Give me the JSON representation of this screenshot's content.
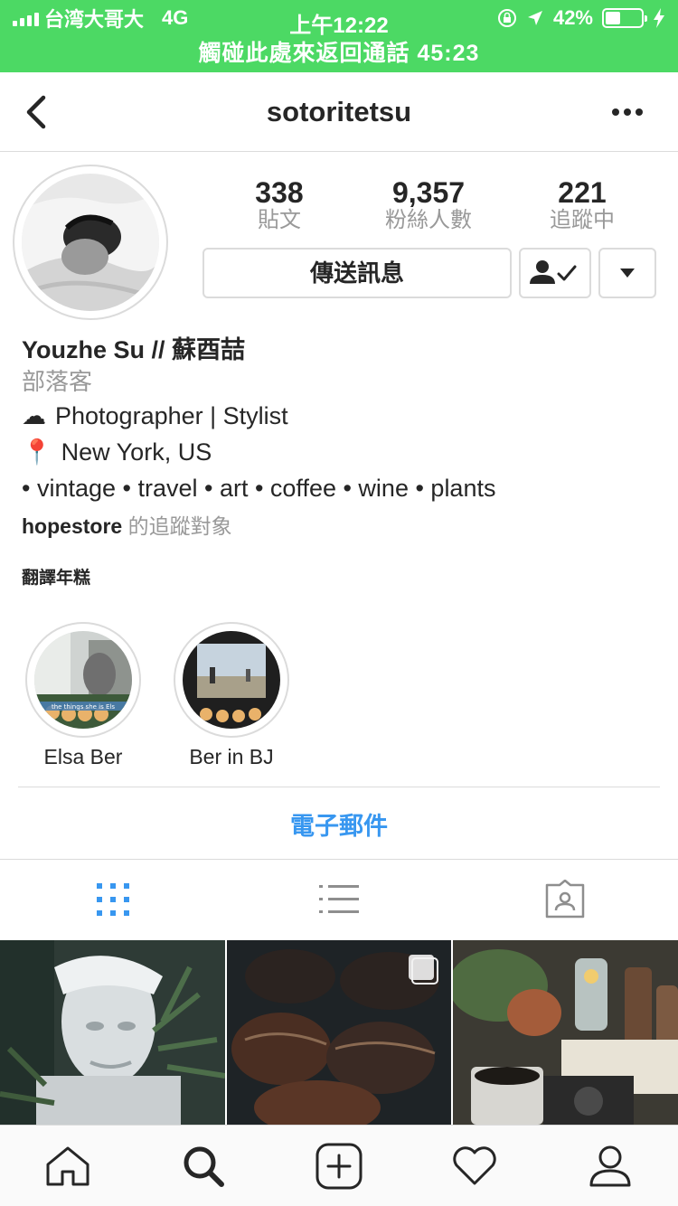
{
  "status_bar": {
    "carrier": "台湾大哥大",
    "network": "4G",
    "time": "上午12:22",
    "battery": "42%",
    "battery_level": 0.42,
    "call_banner": "觸碰此處來返回通話 45:23"
  },
  "nav": {
    "title": "sotoritetsu",
    "back_icon": "chevron-left-icon",
    "more_icon": "more-horizontal-icon"
  },
  "profile": {
    "stats": [
      {
        "value": "338",
        "label": "貼文"
      },
      {
        "value": "9,357",
        "label": "粉絲人數"
      },
      {
        "value": "221",
        "label": "追蹤中"
      }
    ],
    "message_button": "傳送訊息",
    "name": "Youzhe Su // 蘇酉喆",
    "category": "部落客",
    "bio_lines": [
      {
        "emoji": "☁",
        "text": "Photographer | Stylist"
      },
      {
        "emoji": "📍",
        "text": "New York, US"
      },
      {
        "emoji": "",
        "text": "• vintage • travel • art • coffee • wine • plants"
      }
    ],
    "followed_by_user": "hopestore",
    "followed_by_suffix": "的追蹤對象",
    "translate": "翻譯年糕"
  },
  "highlights": [
    {
      "label": "Elsa Ber",
      "caption": "the things she is Els"
    },
    {
      "label": "Ber in BJ"
    }
  ],
  "contact": {
    "email_label": "電子郵件"
  },
  "tabs": [
    {
      "icon": "grid-icon",
      "active": true
    },
    {
      "icon": "list-icon",
      "active": false
    },
    {
      "icon": "tagged-icon",
      "active": false
    }
  ],
  "bottom_nav": [
    {
      "icon": "home-icon"
    },
    {
      "icon": "search-icon"
    },
    {
      "icon": "add-post-icon"
    },
    {
      "icon": "heart-icon"
    },
    {
      "icon": "profile-icon"
    }
  ],
  "colors": {
    "status_green": "#4cd964",
    "link_blue": "#3897f0",
    "border": "#dbdbdb",
    "muted": "#999999"
  }
}
